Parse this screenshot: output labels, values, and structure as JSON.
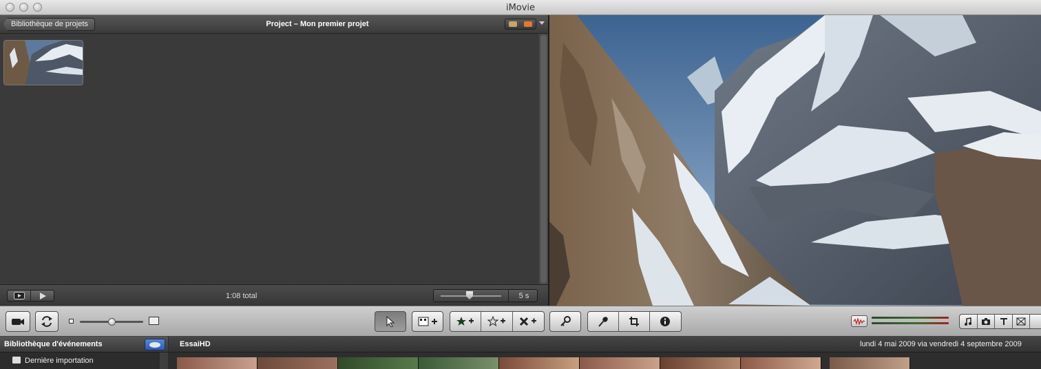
{
  "window": {
    "title": "iMovie"
  },
  "project": {
    "back_label": "Bibliothèque de projets",
    "title": "Project – Mon premier projet",
    "total": "1:08 total",
    "zoom_value": "5 s"
  },
  "events": {
    "library_title": "Bibliothèque d'événements",
    "items": [
      {
        "label": "Dernière importation"
      }
    ],
    "event_name": "EssaiHD",
    "date_range": "lundi 4 mai 2009 via vendredi 4 septembre 2009"
  },
  "icons": {
    "comment_marker": "speech-bubble-icon",
    "chapter_marker": "marker-icon",
    "camera": "camera-icon",
    "swap": "swap-icon",
    "pointer": "pointer-icon",
    "add_to_project": "add-to-project-icon",
    "favorite": "favorite-star-icon",
    "unmark": "unmark-star-icon",
    "reject": "reject-icon",
    "keyword": "key-icon",
    "voiceover": "microphone-icon",
    "crop": "crop-icon",
    "inspector": "info-icon",
    "music": "music-note-icon",
    "photo": "photo-camera-icon",
    "titles": "text-t-icon",
    "transitions": "transition-icon"
  },
  "colors": {
    "accent": "#2b5cb8",
    "favorite_green": "#3bbf3b",
    "reject_red": "#d03a2a"
  }
}
